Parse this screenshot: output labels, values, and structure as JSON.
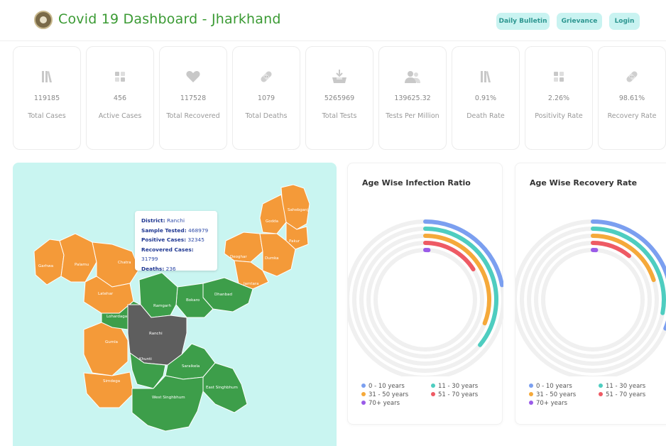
{
  "header": {
    "title": "Covid 19 Dashboard - Jharkhand",
    "nav": [
      {
        "label": "Daily Bulletin"
      },
      {
        "label": "Grievance"
      },
      {
        "label": "Login"
      }
    ]
  },
  "stats": [
    {
      "icon": "bars-icon",
      "value": "119185",
      "label": "Total Cases"
    },
    {
      "icon": "grid-icon",
      "value": "456",
      "label": "Active Cases"
    },
    {
      "icon": "heart-icon",
      "value": "117528",
      "label": "Total Recovered"
    },
    {
      "icon": "bandage-icon",
      "value": "1079",
      "label": "Total Deaths"
    },
    {
      "icon": "test-kit-icon",
      "value": "5265969",
      "label": "Total Tests"
    },
    {
      "icon": "people-icon",
      "value": "139625.32",
      "label": "Tests Per Million"
    },
    {
      "icon": "bars-icon",
      "value": "0.91%",
      "label": "Death Rate"
    },
    {
      "icon": "grid-icon",
      "value": "2.26%",
      "label": "Positivity Rate"
    },
    {
      "icon": "bandage-icon",
      "value": "98.61%",
      "label": "Recovery Rate"
    }
  ],
  "map": {
    "districts": [
      "Sahebganj",
      "Godda",
      "Pakur",
      "Deoghar",
      "Dumka",
      "Jamtara",
      "Garhwa",
      "Palamu",
      "Chatra",
      "Latehar",
      "Dhanbad",
      "Bokaro",
      "Ramgarh",
      "Lohardaga",
      "Ranchi",
      "Gumla",
      "Khunti",
      "Saraikela",
      "Simdega",
      "East Singhbhum",
      "West Singhbhum"
    ],
    "tooltip": {
      "district_label": "District:",
      "district": "Ranchi",
      "tested_label": "Sample Tested:",
      "tested": "468979",
      "positive_label": "Positive Cases:",
      "positive": "32345",
      "recovered_label": "Recovered Cases:",
      "recovered": "31799",
      "deaths_label": "Deaths:",
      "deaths": "236"
    },
    "colors": {
      "orange": "#f49a39",
      "green": "#3d9e4a",
      "selected": "#5e5e5e",
      "water": "#c9f5f1"
    }
  },
  "charts": [
    {
      "title": "Age Wise Infection Ratio",
      "legend": [
        "0 - 10 years",
        "11 - 30 years",
        "31 - 50 years",
        "51 - 70 years",
        "70+ years"
      ]
    },
    {
      "title": "Age Wise Recovery Rate",
      "legend": [
        "0 - 10 years",
        "11 - 30 years",
        "31 - 50 years",
        "51 - 70 years",
        "70+ years"
      ]
    }
  ],
  "chart_data": [
    {
      "type": "radialBar",
      "title": "Age Wise Infection Ratio",
      "categories": [
        "0 - 10 years",
        "11 - 30 years",
        "31 - 50 years",
        "51 - 70 years",
        "70+ years"
      ],
      "values": [
        22,
        36,
        31,
        16,
        1
      ],
      "max": 100,
      "colors": [
        "#7b9ff0",
        "#4ecdc0",
        "#f5a93a",
        "#ee5a64",
        "#9a5be8"
      ]
    },
    {
      "type": "radialBar",
      "title": "Age Wise Recovery Rate",
      "categories": [
        "0 - 10 years",
        "11 - 30 years",
        "31 - 50 years",
        "51 - 70 years",
        "70+ years"
      ],
      "values": [
        31,
        28,
        20,
        11,
        1
      ],
      "max": 100,
      "colors": [
        "#7b9ff0",
        "#4ecdc0",
        "#f5a93a",
        "#ee5a64",
        "#9a5be8"
      ]
    }
  ]
}
